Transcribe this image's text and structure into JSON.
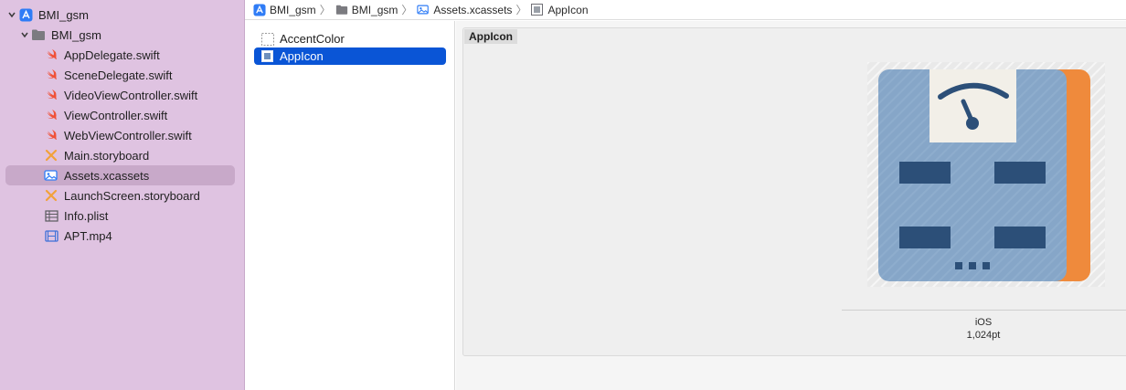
{
  "navigator": {
    "items": [
      {
        "label": "BMI_gsm",
        "icon": "xcode-project-icon",
        "expanded": true
      },
      {
        "label": "BMI_gsm",
        "icon": "folder-icon",
        "expanded": true
      },
      {
        "label": "AppDelegate.swift",
        "icon": "swift-file-icon"
      },
      {
        "label": "SceneDelegate.swift",
        "icon": "swift-file-icon"
      },
      {
        "label": "VideoViewController.swift",
        "icon": "swift-file-icon"
      },
      {
        "label": "ViewController.swift",
        "icon": "swift-file-icon"
      },
      {
        "label": "WebViewController.swift",
        "icon": "swift-file-icon"
      },
      {
        "label": "Main.storyboard",
        "icon": "storyboard-icon"
      },
      {
        "label": "Assets.xcassets",
        "icon": "asset-catalog-icon",
        "selected": true
      },
      {
        "label": "LaunchScreen.storyboard",
        "icon": "storyboard-icon"
      },
      {
        "label": "Info.plist",
        "icon": "plist-icon"
      },
      {
        "label": "APT.mp4",
        "icon": "video-file-icon"
      }
    ]
  },
  "jumpbar": {
    "crumbs": [
      {
        "label": "BMI_gsm",
        "icon": "xcode-project-icon"
      },
      {
        "label": "BMI_gsm",
        "icon": "folder-icon"
      },
      {
        "label": "Assets.xcassets",
        "icon": "asset-catalog-icon"
      },
      {
        "label": "AppIcon",
        "icon": "app-icon-set-icon"
      }
    ]
  },
  "assets": {
    "items": [
      {
        "label": "AccentColor",
        "icon": "color-set-icon"
      },
      {
        "label": "AppIcon",
        "icon": "app-icon-set-icon",
        "selected": true
      }
    ]
  },
  "detail": {
    "set_name": "AppIcon",
    "slot_platform": "iOS",
    "slot_size": "1,024pt"
  },
  "colors": {
    "sidebar_bg": "#dfc3e1",
    "selection_blue": "#0a55d6",
    "swift_orange": "#f05138",
    "icon_blue": "#86a6c8",
    "icon_dark_blue": "#2c4f78",
    "icon_orange": "#ef8a3c"
  }
}
